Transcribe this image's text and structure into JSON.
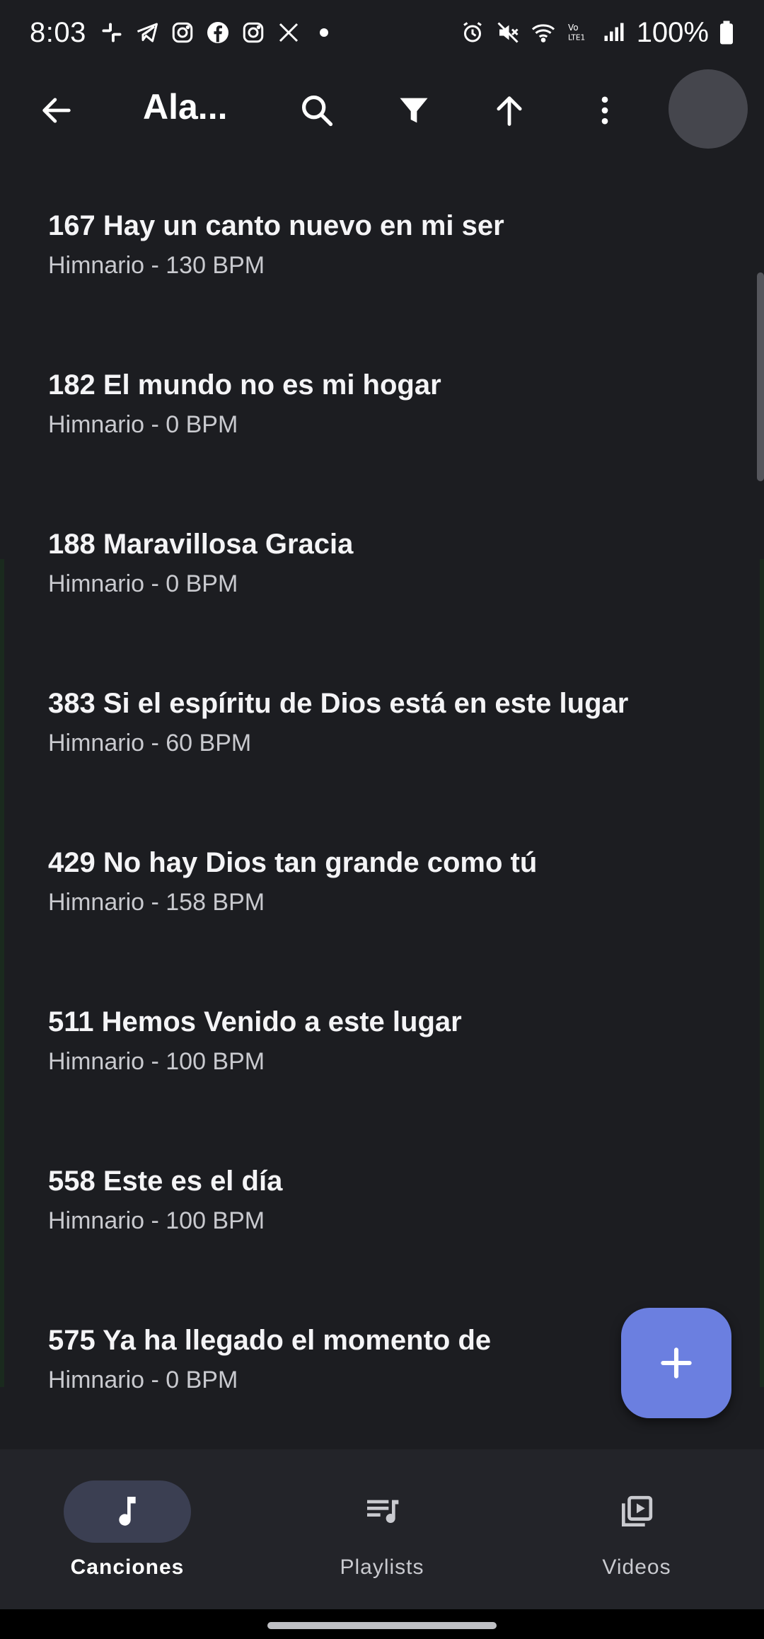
{
  "status_bar": {
    "time": "8:03",
    "battery": "100%",
    "left_icons": [
      "slack-icon",
      "telegram-icon",
      "instagram-icon",
      "facebook-icon",
      "instagram-icon",
      "x-icon",
      "dot-icon"
    ],
    "right_icons": [
      "alarm-icon",
      "mute-icon",
      "wifi-icon",
      "volte-icon",
      "signal-icon",
      "battery-icon"
    ]
  },
  "toolbar": {
    "title": "Ala...",
    "icons": [
      "back-arrow-icon",
      "search-icon",
      "filter-icon",
      "sort-arrow-up-icon",
      "more-vert-icon"
    ]
  },
  "songs": [
    {
      "title": "167 Hay un canto nuevo en mi ser",
      "subtitle": "Himnario - 130 BPM"
    },
    {
      "title": "182 El mundo no es mi hogar",
      "subtitle": "Himnario - 0 BPM"
    },
    {
      "title": "188 Maravillosa Gracia",
      "subtitle": "Himnario - 0 BPM"
    },
    {
      "title": "383 Si el espíritu de Dios está en este lugar",
      "subtitle": "Himnario - 60 BPM"
    },
    {
      "title": "429 No hay Dios tan grande como tú",
      "subtitle": "Himnario - 158 BPM"
    },
    {
      "title": "511 Hemos Venido a este lugar",
      "subtitle": "Himnario - 100 BPM"
    },
    {
      "title": "558 Este es el día",
      "subtitle": "Himnario - 100 BPM"
    },
    {
      "title": "575 Ya ha llegado el momento de",
      "subtitle": "Himnario - 0 BPM"
    }
  ],
  "fab": {
    "icon": "plus-icon"
  },
  "bottom_nav": [
    {
      "label": "Canciones",
      "icon": "music-note-icon",
      "active": true
    },
    {
      "label": "Playlists",
      "icon": "playlist-icon",
      "active": false
    },
    {
      "label": "Videos",
      "icon": "video-library-icon",
      "active": false
    }
  ],
  "colors": {
    "background": "#1c1d21",
    "nav_background": "#232429",
    "accent": "#6b7fe0",
    "active_pill": "#3b3f52"
  }
}
